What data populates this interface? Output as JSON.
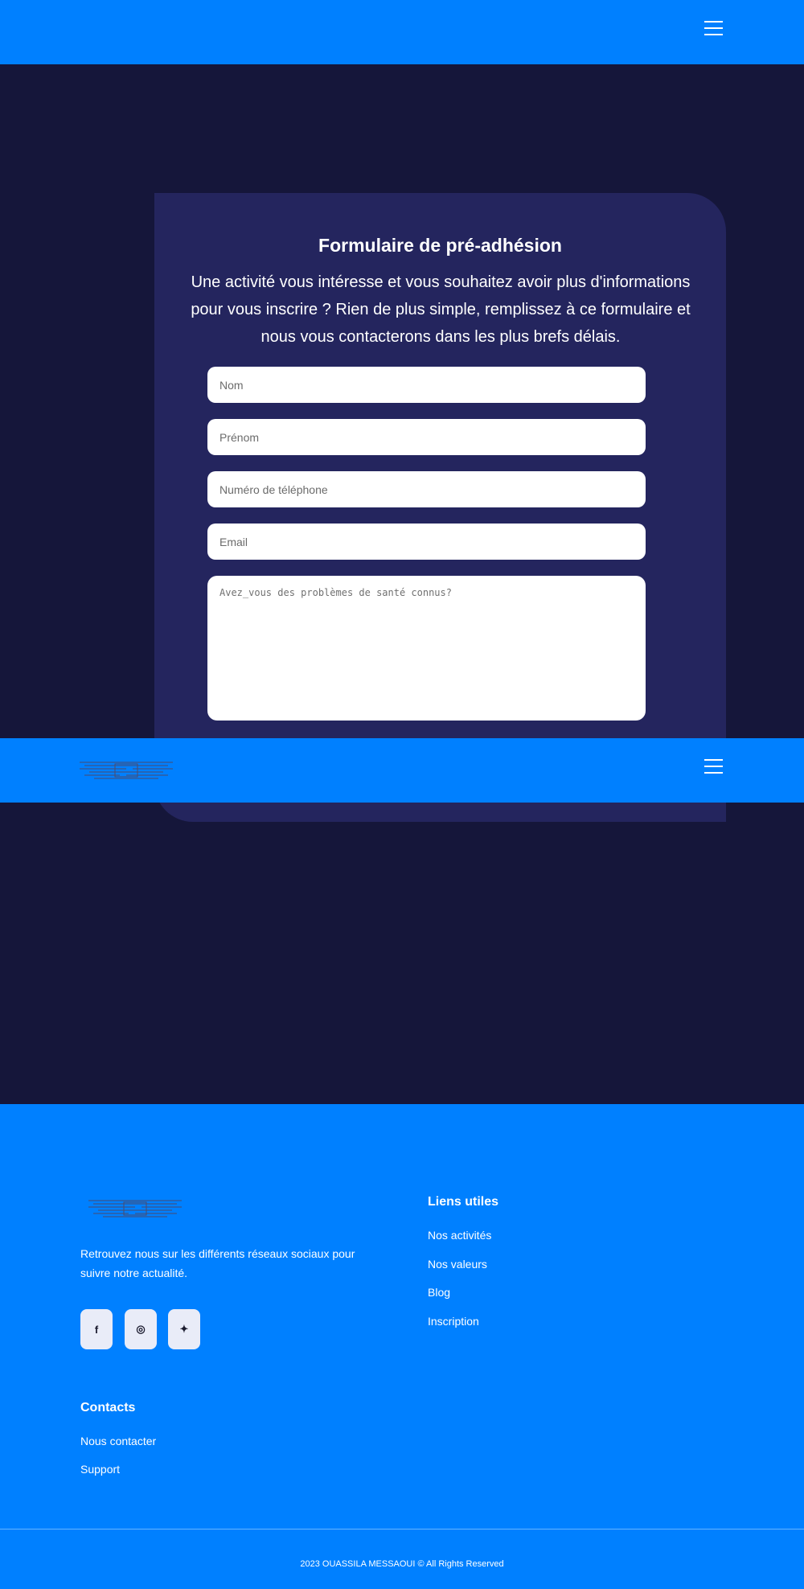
{
  "header": {
    "menu_icon": "hamburger-menu-icon"
  },
  "form": {
    "title": "Formulaire de pré-adhésion",
    "description": "Une activité vous intéresse et vous souhaitez avoir plus d'informations pour vous inscrire ? Rien de plus simple, remplissez à ce formulaire et nous vous contacterons dans les plus brefs délais.",
    "fields": {
      "nom": {
        "placeholder": "Nom"
      },
      "prenom": {
        "placeholder": "Prénom"
      },
      "telephone": {
        "placeholder": "Numéro de téléphone"
      },
      "email": {
        "placeholder": "Email"
      },
      "sante": {
        "placeholder": "Avez_vous des problèmes de santé connus?"
      }
    }
  },
  "sticky_nav": {
    "logo_icon": "logo-icon",
    "menu_icon": "hamburger-menu-icon"
  },
  "footer": {
    "text": "Retrouvez nous sur les différents réseaux sociaux pour suivre notre actualité.",
    "social": [
      {
        "name": "facebook-icon",
        "glyph": "f"
      },
      {
        "name": "instagram-icon",
        "glyph": "◎"
      },
      {
        "name": "twitter-icon",
        "glyph": "✦"
      }
    ],
    "contacts": {
      "title": "Contacts",
      "links": [
        "Nous contacter",
        "Support"
      ]
    },
    "liens": {
      "title": "Liens utiles",
      "links": [
        "Nos activités",
        "Nos valeurs",
        "Blog",
        "Inscription"
      ]
    },
    "copyright": "2023 OUASSILA MESSAOUI © All Rights Reserved"
  },
  "colors": {
    "primary": "#0080ff",
    "background": "#15163a",
    "card": "#24255e"
  }
}
